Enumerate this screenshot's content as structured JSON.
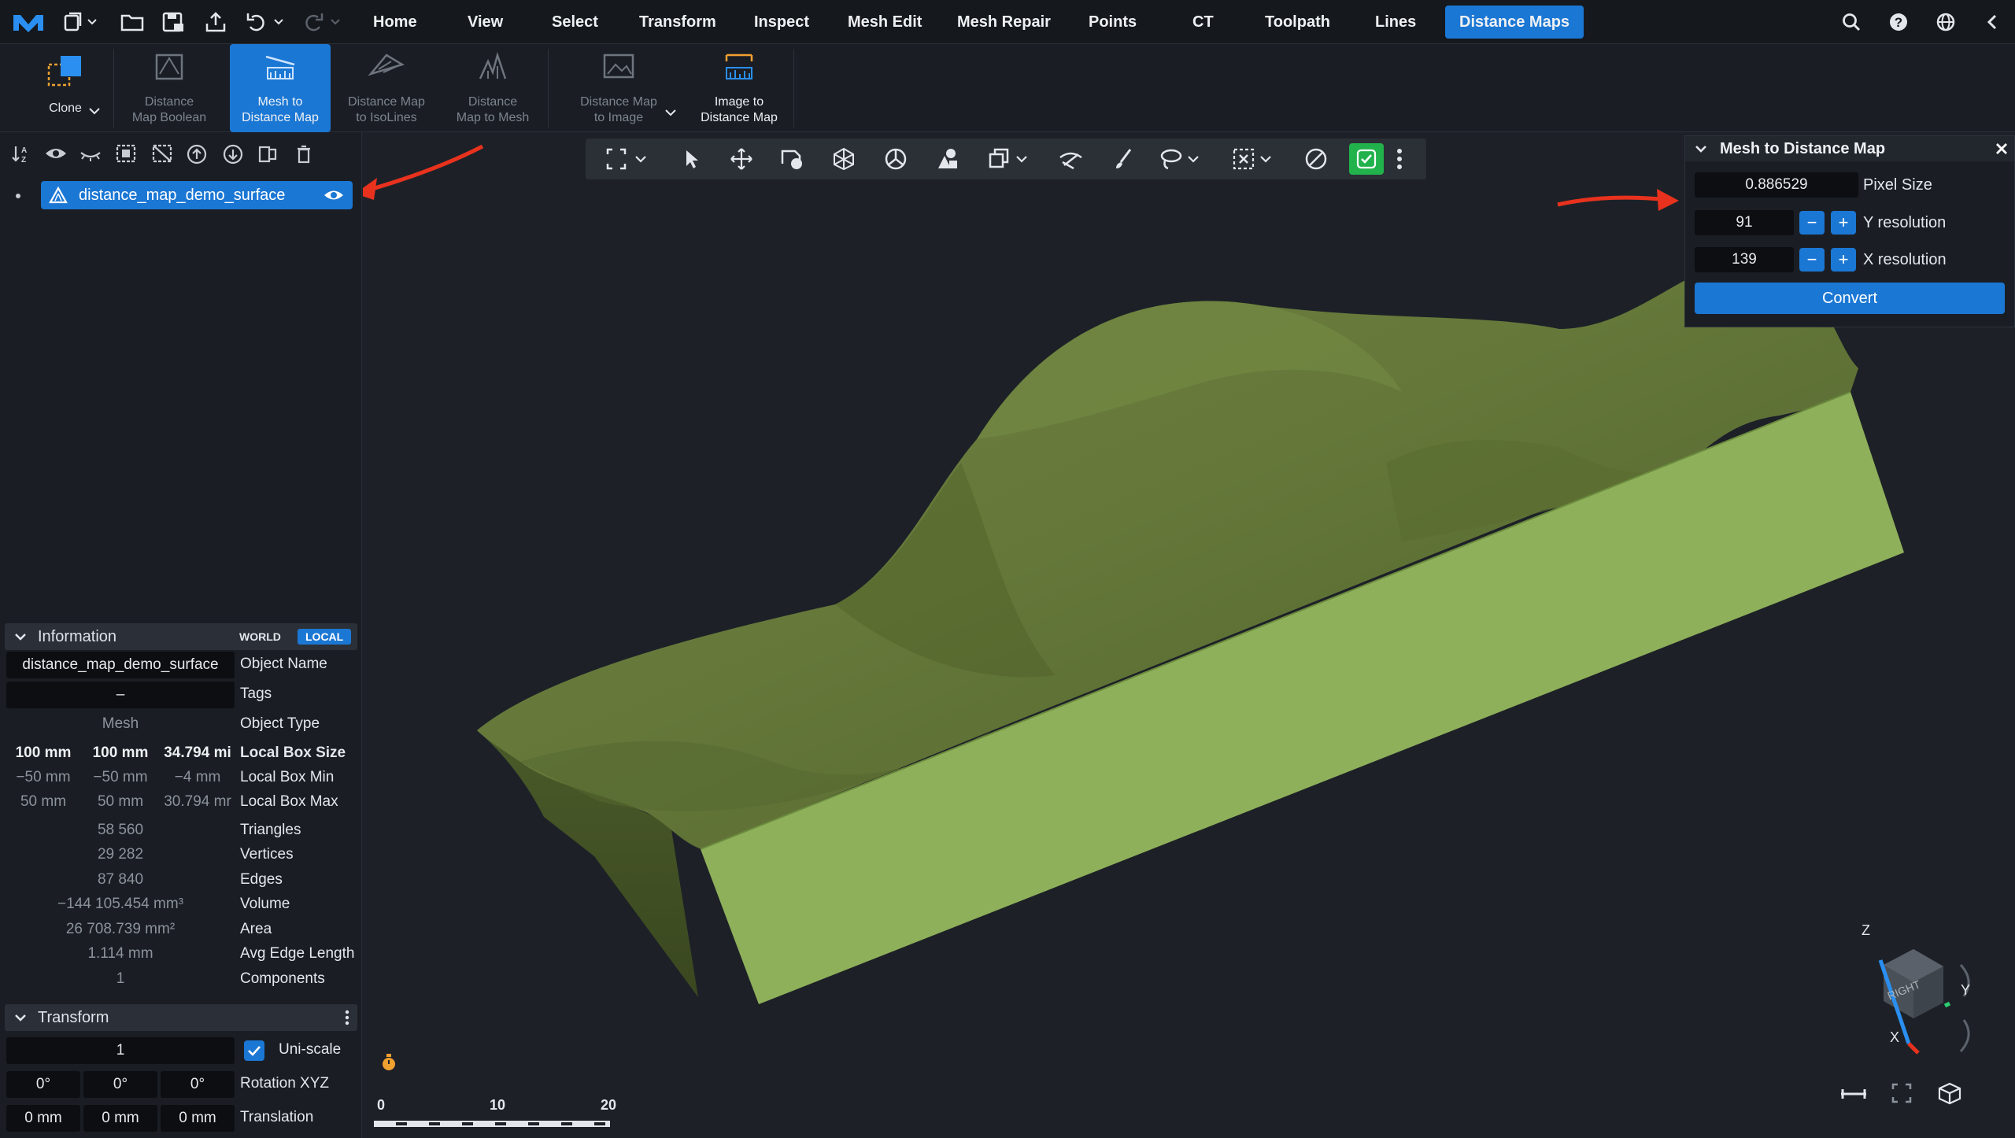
{
  "topbar": {
    "menus": [
      "Home",
      "View",
      "Select",
      "Transform",
      "Inspect",
      "Mesh Edit",
      "Mesh Repair",
      "Points",
      "CT",
      "Toolpath",
      "Lines",
      "Distance Maps"
    ],
    "active_menu": "Distance Maps"
  },
  "ribbon": {
    "clone": "Clone",
    "buttons": [
      {
        "l1": "Distance",
        "l2": "Map Boolean"
      },
      {
        "l1": "Mesh to",
        "l2": "Distance Map"
      },
      {
        "l1": "Distance Map",
        "l2": "to IsoLines"
      },
      {
        "l1": "Distance",
        "l2": "Map to Mesh"
      },
      {
        "l1": "Distance Map",
        "l2": "to Image"
      },
      {
        "l1": "Image to",
        "l2": "Distance Map"
      }
    ]
  },
  "scene": {
    "object": "distance_map_demo_surface"
  },
  "information": {
    "title": "Information",
    "world": "WORLD",
    "local": "LOCAL",
    "object_name": "distance_map_demo_surface",
    "object_name_label": "Object Name",
    "tags": "–",
    "tags_label": "Tags",
    "object_type": "Mesh",
    "object_type_label": "Object Type",
    "box_size": [
      "100 mm",
      "100 mm",
      "34.794 mi"
    ],
    "box_size_label": "Local Box Size",
    "box_min": [
      "−50 mm",
      "−50 mm",
      "−4 mm"
    ],
    "box_min_label": "Local Box Min",
    "box_max": [
      "50 mm",
      "50 mm",
      "30.794 mr"
    ],
    "box_max_label": "Local Box Max",
    "stats": [
      {
        "value": "58 560",
        "label": "Triangles"
      },
      {
        "value": "29 282",
        "label": "Vertices"
      },
      {
        "value": "87 840",
        "label": "Edges"
      },
      {
        "value": "−144 105.454 mm³",
        "label": "Volume"
      },
      {
        "value": "26 708.739 mm²",
        "label": "Area"
      },
      {
        "value": "1.114 mm",
        "label": "Avg Edge Length"
      },
      {
        "value": "1",
        "label": "Components"
      }
    ]
  },
  "transform": {
    "title": "Transform",
    "scale": "1",
    "uniscale": "Uni-scale",
    "rotation": [
      "0°",
      "0°",
      "0°"
    ],
    "rotation_label": "Rotation XYZ",
    "translation": [
      "0 mm",
      "0 mm",
      "0 mm"
    ],
    "translation_label": "Translation"
  },
  "panel": {
    "title": "Mesh to Distance Map",
    "pixel_size": "0.886529",
    "pixel_size_label": "Pixel Size",
    "y_res": "91",
    "y_res_label": "Y resolution",
    "x_res": "139",
    "x_res_label": "X resolution",
    "convert": "Convert"
  },
  "scale_bar": {
    "ticks": [
      "0",
      "10",
      "20"
    ]
  },
  "axes": {
    "z": "Z",
    "y": "Y",
    "x": "X",
    "face": "RIGHT"
  },
  "colors": {
    "accent": "#1b77d4",
    "surface": "#6b7d3c",
    "front": "#8fb05a",
    "arrow": "#e8321e"
  }
}
